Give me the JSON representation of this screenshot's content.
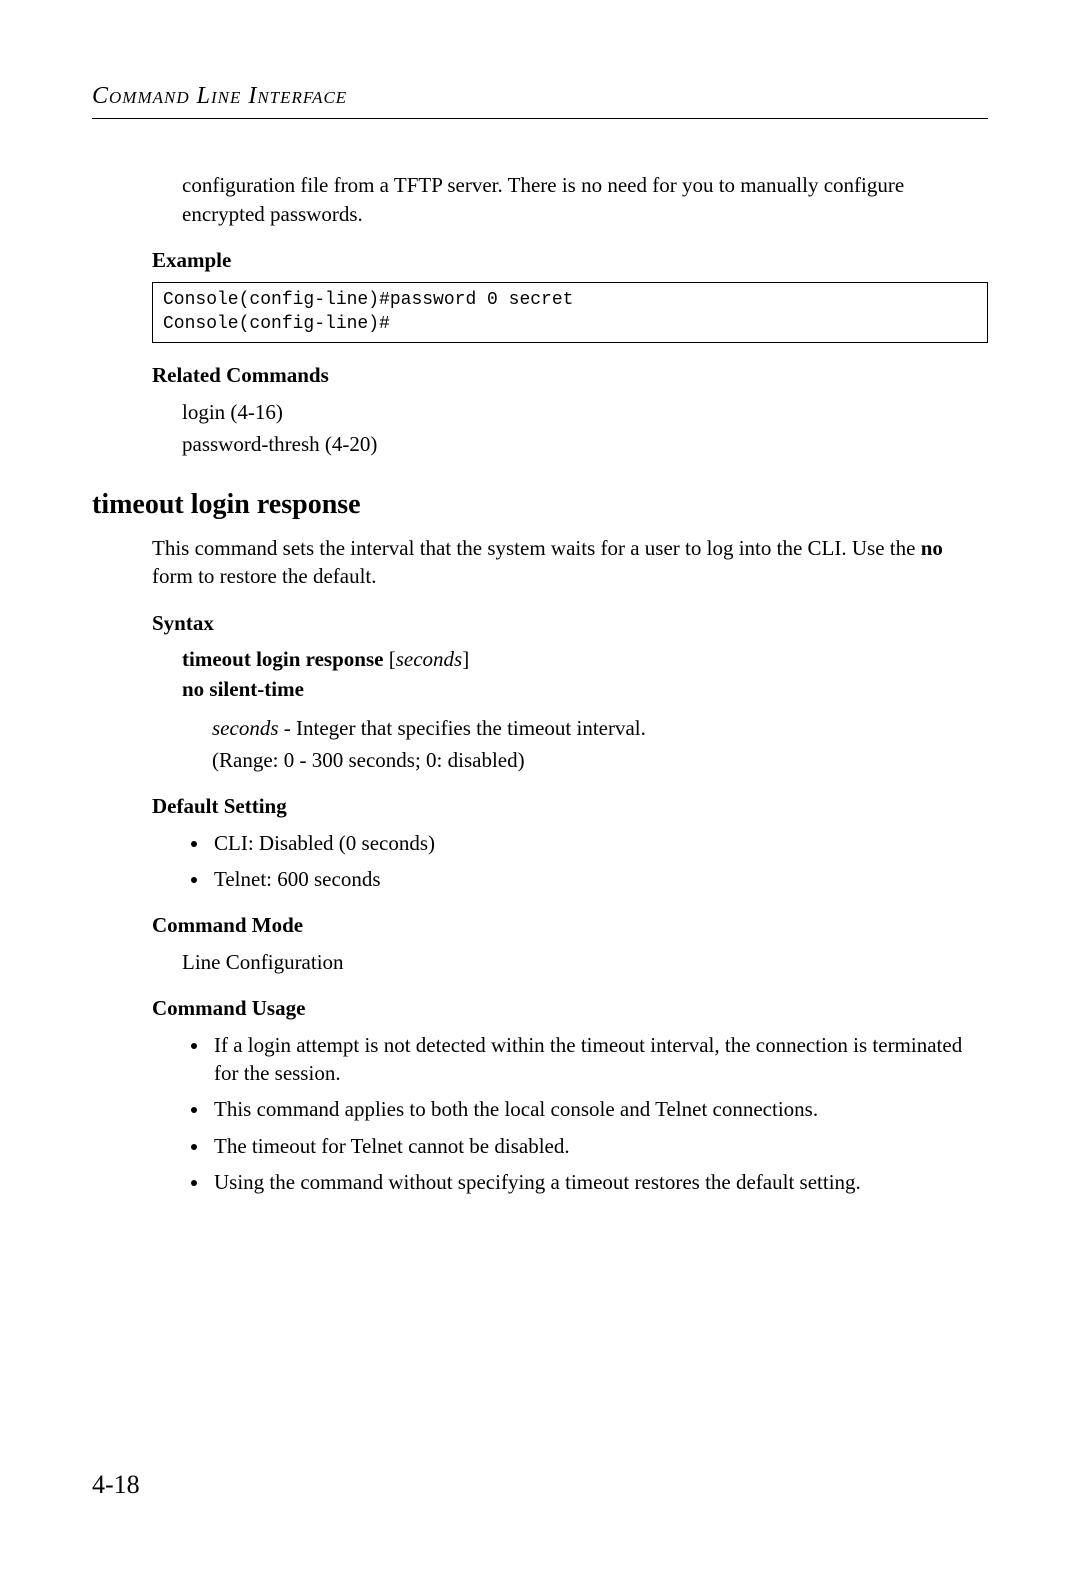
{
  "runningHead": "Command Line Interface",
  "introPara": "configuration file from a TFTP server. There is no need for you to manually configure encrypted passwords.",
  "exampleHeading": "Example",
  "codeLine1": "Console(config-line)#password 0 secret",
  "codeLine2": "Console(config-line)#",
  "relatedHeading": "Related Commands",
  "related1": "login (4-16)",
  "related2": "password-thresh (4-20)",
  "sectionTitle": "timeout login response",
  "sectionIntroA": "This command sets the interval that the system waits for a user to log into the CLI. Use the ",
  "sectionIntroBold": "no",
  "sectionIntroB": " form to restore the default.",
  "syntaxHeading": "Syntax",
  "syntaxCmd": "timeout login response",
  "syntaxArgSeconds": "seconds",
  "syntaxNo": "no silent-time",
  "syntaxSecondsLabel": "seconds",
  "syntaxSecondsDesc": " - Integer that specifies the timeout interval.",
  "syntaxRange": "(Range: 0 - 300 seconds; 0: disabled)",
  "defaultHeading": "Default Setting",
  "default1": "CLI: Disabled (0 seconds)",
  "default2": "Telnet: 600 seconds",
  "modeHeading": "Command Mode",
  "modeText": "Line Configuration",
  "usageHeading": "Command Usage",
  "usage1": "If a login attempt is not detected within the timeout interval, the connection is terminated for the session.",
  "usage2": "This command applies to both the local console and Telnet connections.",
  "usage3": "The timeout for Telnet cannot be disabled.",
  "usage4": "Using the command without specifying a timeout restores the default setting.",
  "pageNum": "4-18"
}
